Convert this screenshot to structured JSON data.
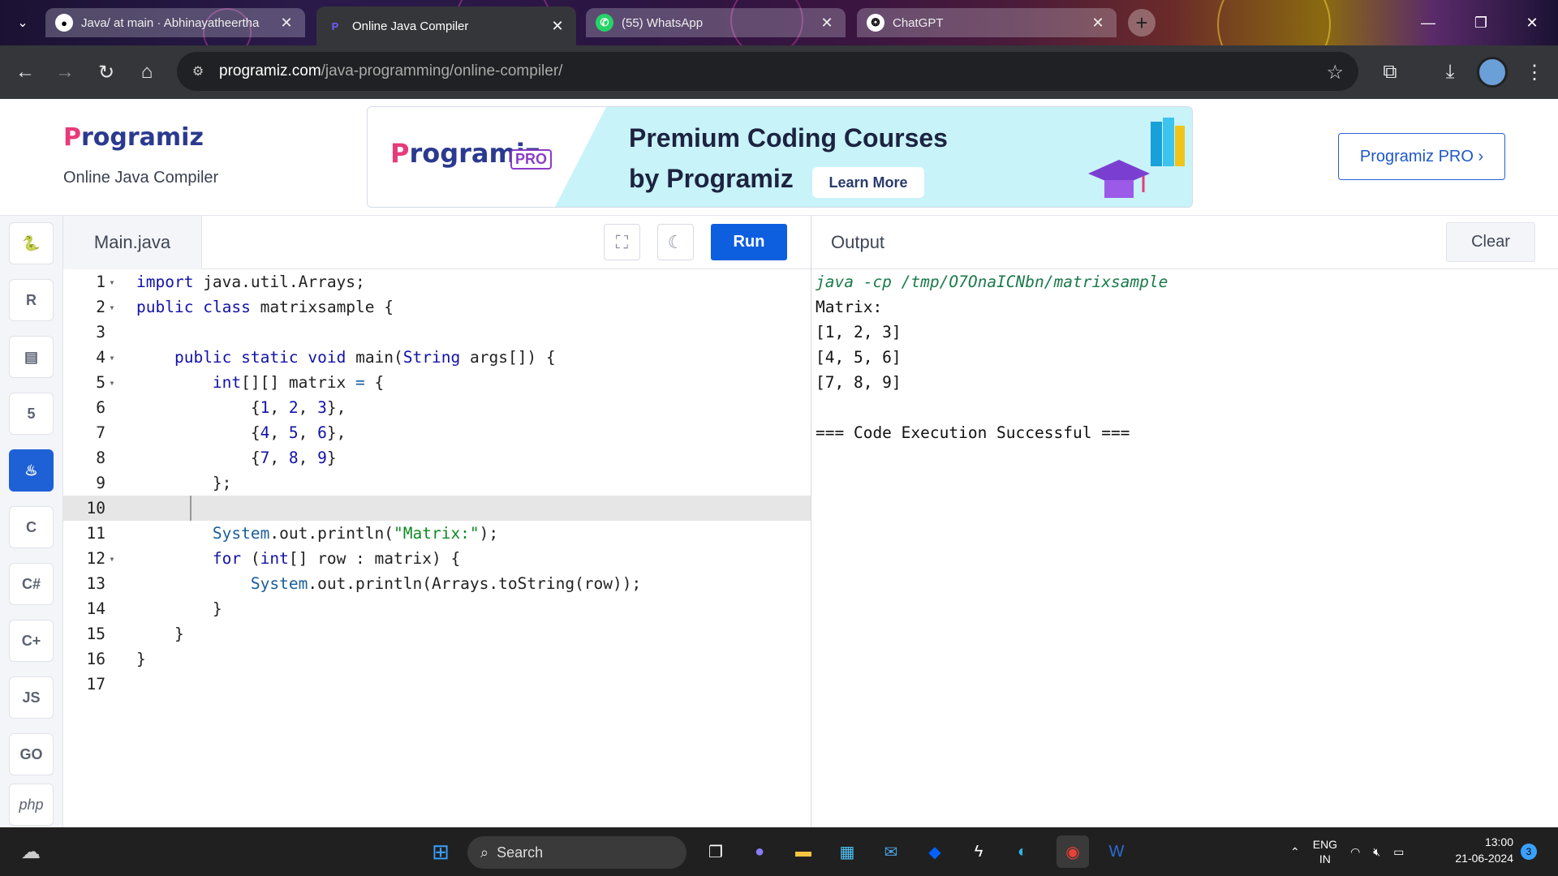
{
  "browser": {
    "tabs": [
      {
        "label": "Java/ at main · Abhinayatheertha",
        "icon": "github-icon"
      },
      {
        "label": "Online Java Compiler",
        "icon": "programiz-icon"
      },
      {
        "label": "(55) WhatsApp",
        "icon": "whatsapp-icon"
      },
      {
        "label": "ChatGPT",
        "icon": "chatgpt-icon"
      }
    ],
    "active_tab": 1,
    "url_host": "programiz.com",
    "url_path": "/java-programming/online-compiler/"
  },
  "header": {
    "logo": "rogramiz",
    "logo_p": "P",
    "subtitle": "Online Java Compiler",
    "banner": {
      "logo": "rogramiz",
      "logo_p": "P",
      "pro_badge": "PRO",
      "line1": "Premium Coding Courses",
      "line2": "by Programiz",
      "cta": "Learn More"
    },
    "pro_button": "Programiz PRO ›"
  },
  "sidebar": {
    "languages": [
      {
        "name": "python",
        "glyph": "🐍"
      },
      {
        "name": "r",
        "glyph": "R"
      },
      {
        "name": "sql",
        "glyph": "▤"
      },
      {
        "name": "html",
        "glyph": "5"
      },
      {
        "name": "java",
        "glyph": "♨"
      },
      {
        "name": "c",
        "glyph": "C"
      },
      {
        "name": "csharp",
        "glyph": "C#"
      },
      {
        "name": "cpp",
        "glyph": "C+"
      },
      {
        "name": "javascript",
        "glyph": "JS"
      },
      {
        "name": "go",
        "glyph": "GO"
      },
      {
        "name": "php",
        "glyph": "php"
      }
    ],
    "active": 4
  },
  "editor": {
    "file": "Main.java",
    "run_label": "Run",
    "current_line": 10,
    "lines": [
      {
        "n": "1",
        "fold": true,
        "code": "import java.util.Arrays;"
      },
      {
        "n": "2",
        "fold": true,
        "code": "public class matrixsample {"
      },
      {
        "n": "3",
        "fold": false,
        "code": ""
      },
      {
        "n": "4",
        "fold": true,
        "code": "    public static void main(String args[]) {"
      },
      {
        "n": "5",
        "fold": true,
        "code": "        int[][] matrix = {"
      },
      {
        "n": "6",
        "fold": false,
        "code": "            {1, 2, 3},"
      },
      {
        "n": "7",
        "fold": false,
        "code": "            {4, 5, 6},"
      },
      {
        "n": "8",
        "fold": false,
        "code": "            {7, 8, 9}"
      },
      {
        "n": "9",
        "fold": false,
        "code": "        };"
      },
      {
        "n": "10",
        "fold": false,
        "code": ""
      },
      {
        "n": "11",
        "fold": false,
        "code": "        System.out.println(\"Matrix:\");"
      },
      {
        "n": "12",
        "fold": true,
        "code": "        for (int[] row : matrix) {"
      },
      {
        "n": "13",
        "fold": false,
        "code": "            System.out.println(Arrays.toString(row));"
      },
      {
        "n": "14",
        "fold": false,
        "code": "        }"
      },
      {
        "n": "15",
        "fold": false,
        "code": "    }"
      },
      {
        "n": "16",
        "fold": false,
        "code": "}"
      },
      {
        "n": "17",
        "fold": false,
        "code": ""
      }
    ]
  },
  "output": {
    "title": "Output",
    "clear_label": "Clear",
    "lines": [
      "java -cp /tmp/O7OnaICNbn/matrixsample",
      "Matrix:",
      "[1, 2, 3]",
      "[4, 5, 6]",
      "[7, 8, 9]",
      "",
      "=== Code Execution Successful ==="
    ]
  },
  "taskbar": {
    "search_placeholder": "Search",
    "lang_line1": "ENG",
    "lang_line2": "IN",
    "time": "13:00",
    "date": "21-06-2024",
    "notifications": "3"
  },
  "colors": {
    "accent": "#0e5ee0",
    "keyword": "#1212a8",
    "string": "#0d8a22"
  }
}
